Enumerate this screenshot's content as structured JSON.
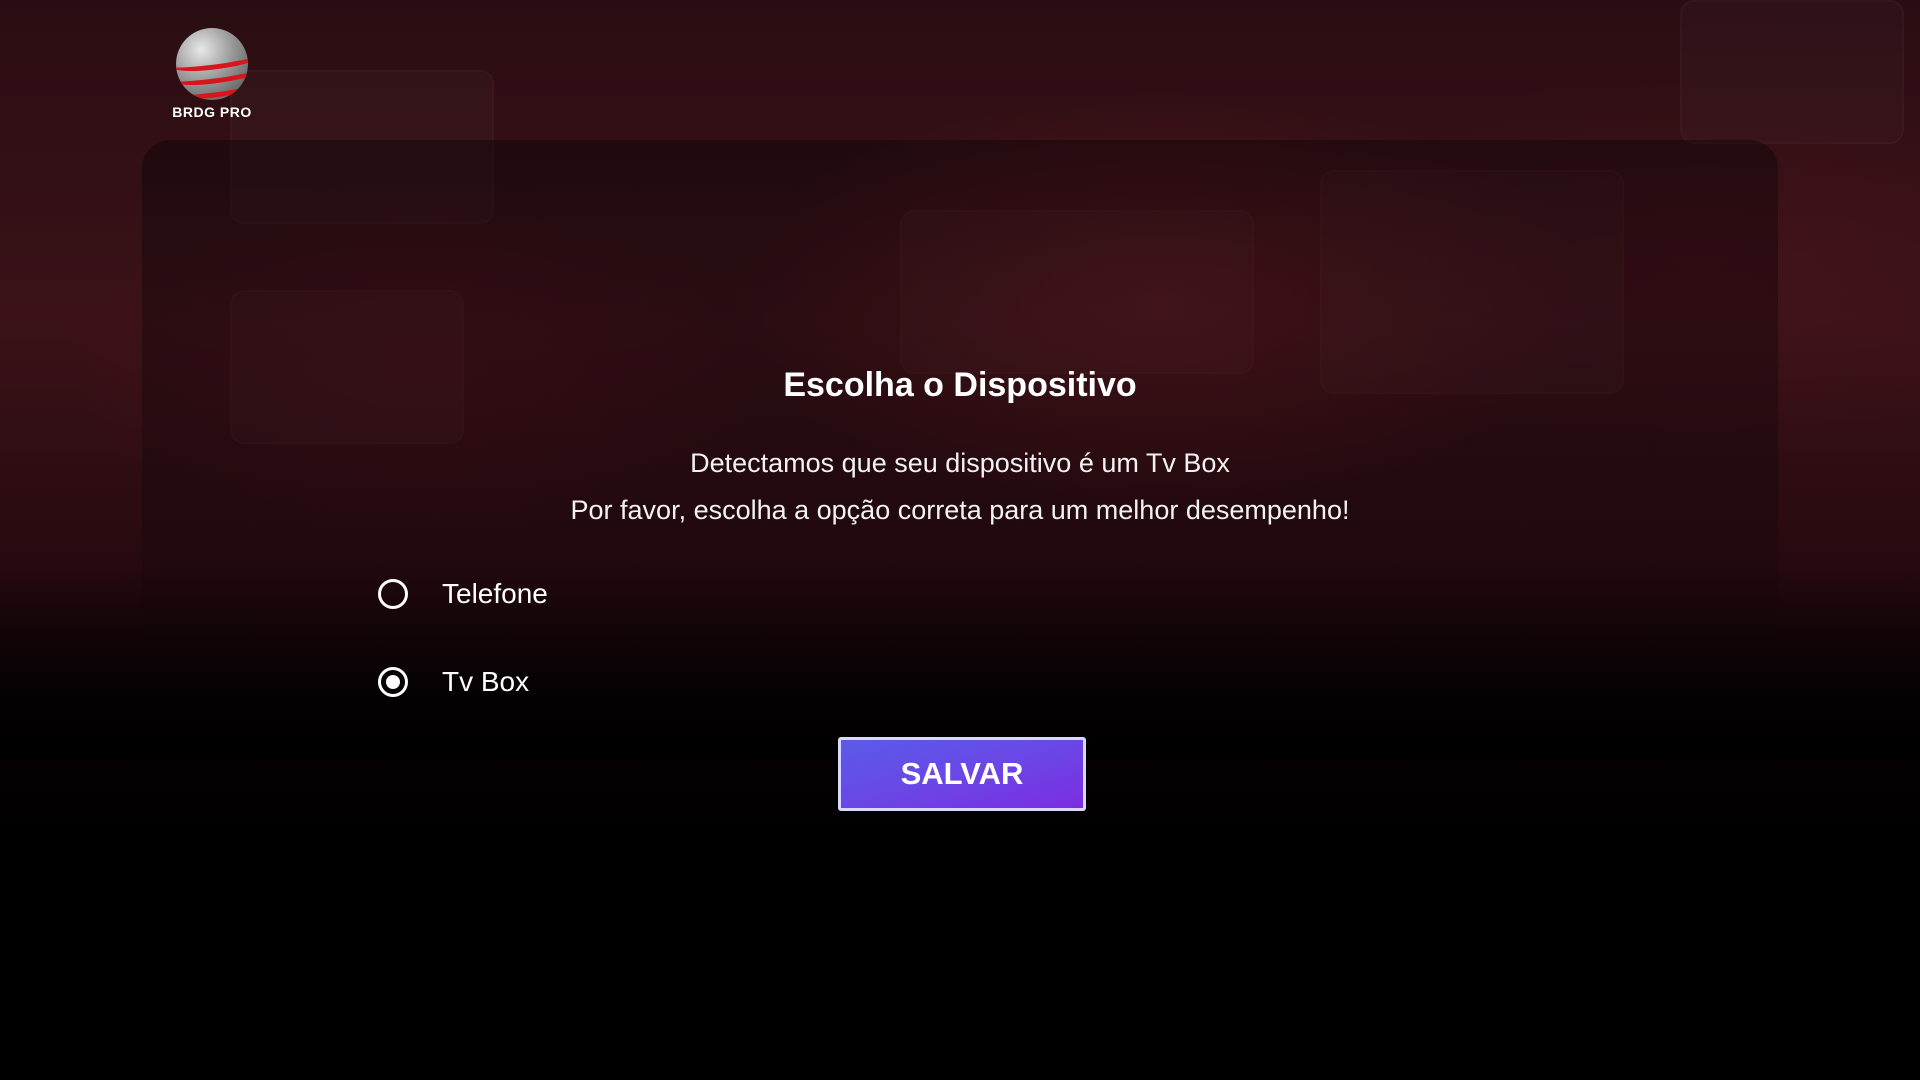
{
  "brand": {
    "name": "BRDG PRO",
    "icon": "globe-logo-icon",
    "accent_color": "#d8141c"
  },
  "dialog": {
    "title": "Escolha o Dispositivo",
    "message_line1": "Detectamos que seu dispositivo é um Tv Box",
    "message_line2": "Por favor, escolha a opção correta para um melhor desempenho!",
    "options": [
      {
        "label": "Telefone",
        "selected": false
      },
      {
        "label": "Tv Box",
        "selected": true
      }
    ],
    "save_label": "SALVAR",
    "save_button_color": "#6a47e6"
  }
}
